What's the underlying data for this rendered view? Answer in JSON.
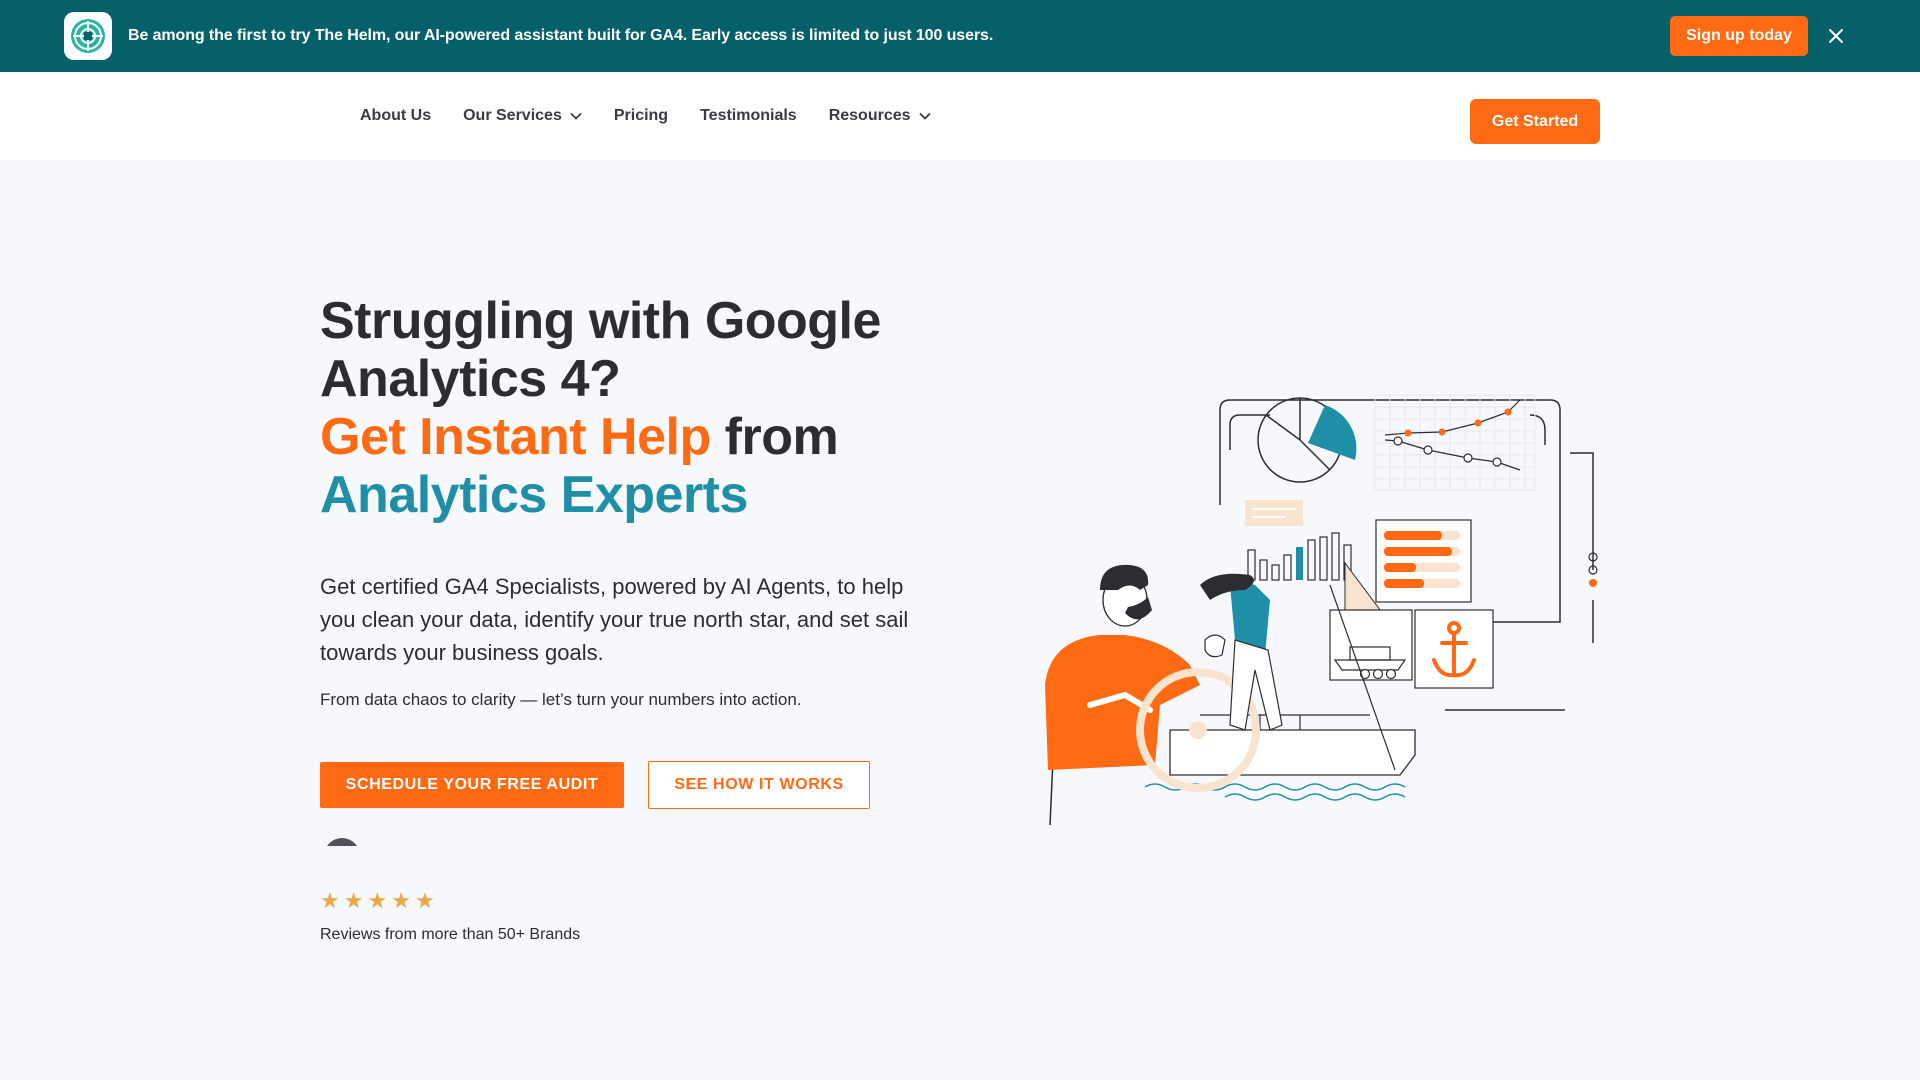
{
  "announcement": {
    "logo_icon": "helm-logo-icon",
    "text": "Be among the first to try The Helm, our AI-powered assistant built for GA4. Early access is limited to just 100 users.",
    "cta_label": "Sign up today",
    "close_icon": "close-icon"
  },
  "nav": {
    "items": [
      {
        "label": "About Us",
        "has_dropdown": false
      },
      {
        "label": "Our Services",
        "has_dropdown": true
      },
      {
        "label": "Pricing",
        "has_dropdown": false
      },
      {
        "label": "Testimonials",
        "has_dropdown": false
      },
      {
        "label": "Resources",
        "has_dropdown": true
      }
    ],
    "cta_label": "Get Started"
  },
  "hero": {
    "headline_line1": "Struggling with Google Analytics 4?",
    "headline_highlight1": "Get Instant Help",
    "headline_mid": " from ",
    "headline_highlight2": "Analytics Experts",
    "description": "Get certified GA4 Specialists, powered by AI Agents, to help you clean your data, identify your true north star, and set sail towards your business goals.",
    "subtext": "From data chaos to clarity — let’s turn your numbers into action.",
    "primary_cta": "SCHEDULE YOUR FREE AUDIT",
    "secondary_cta": "SEE HOW IT WORKS",
    "rating_stars": 5,
    "reviews_text": "Reviews from more than 50+ Brands"
  },
  "colors": {
    "brand_teal": "#06606a",
    "accent_orange": "#ff6a13",
    "highlight_teal": "#1f8fa8",
    "star": "#e9a94b"
  }
}
